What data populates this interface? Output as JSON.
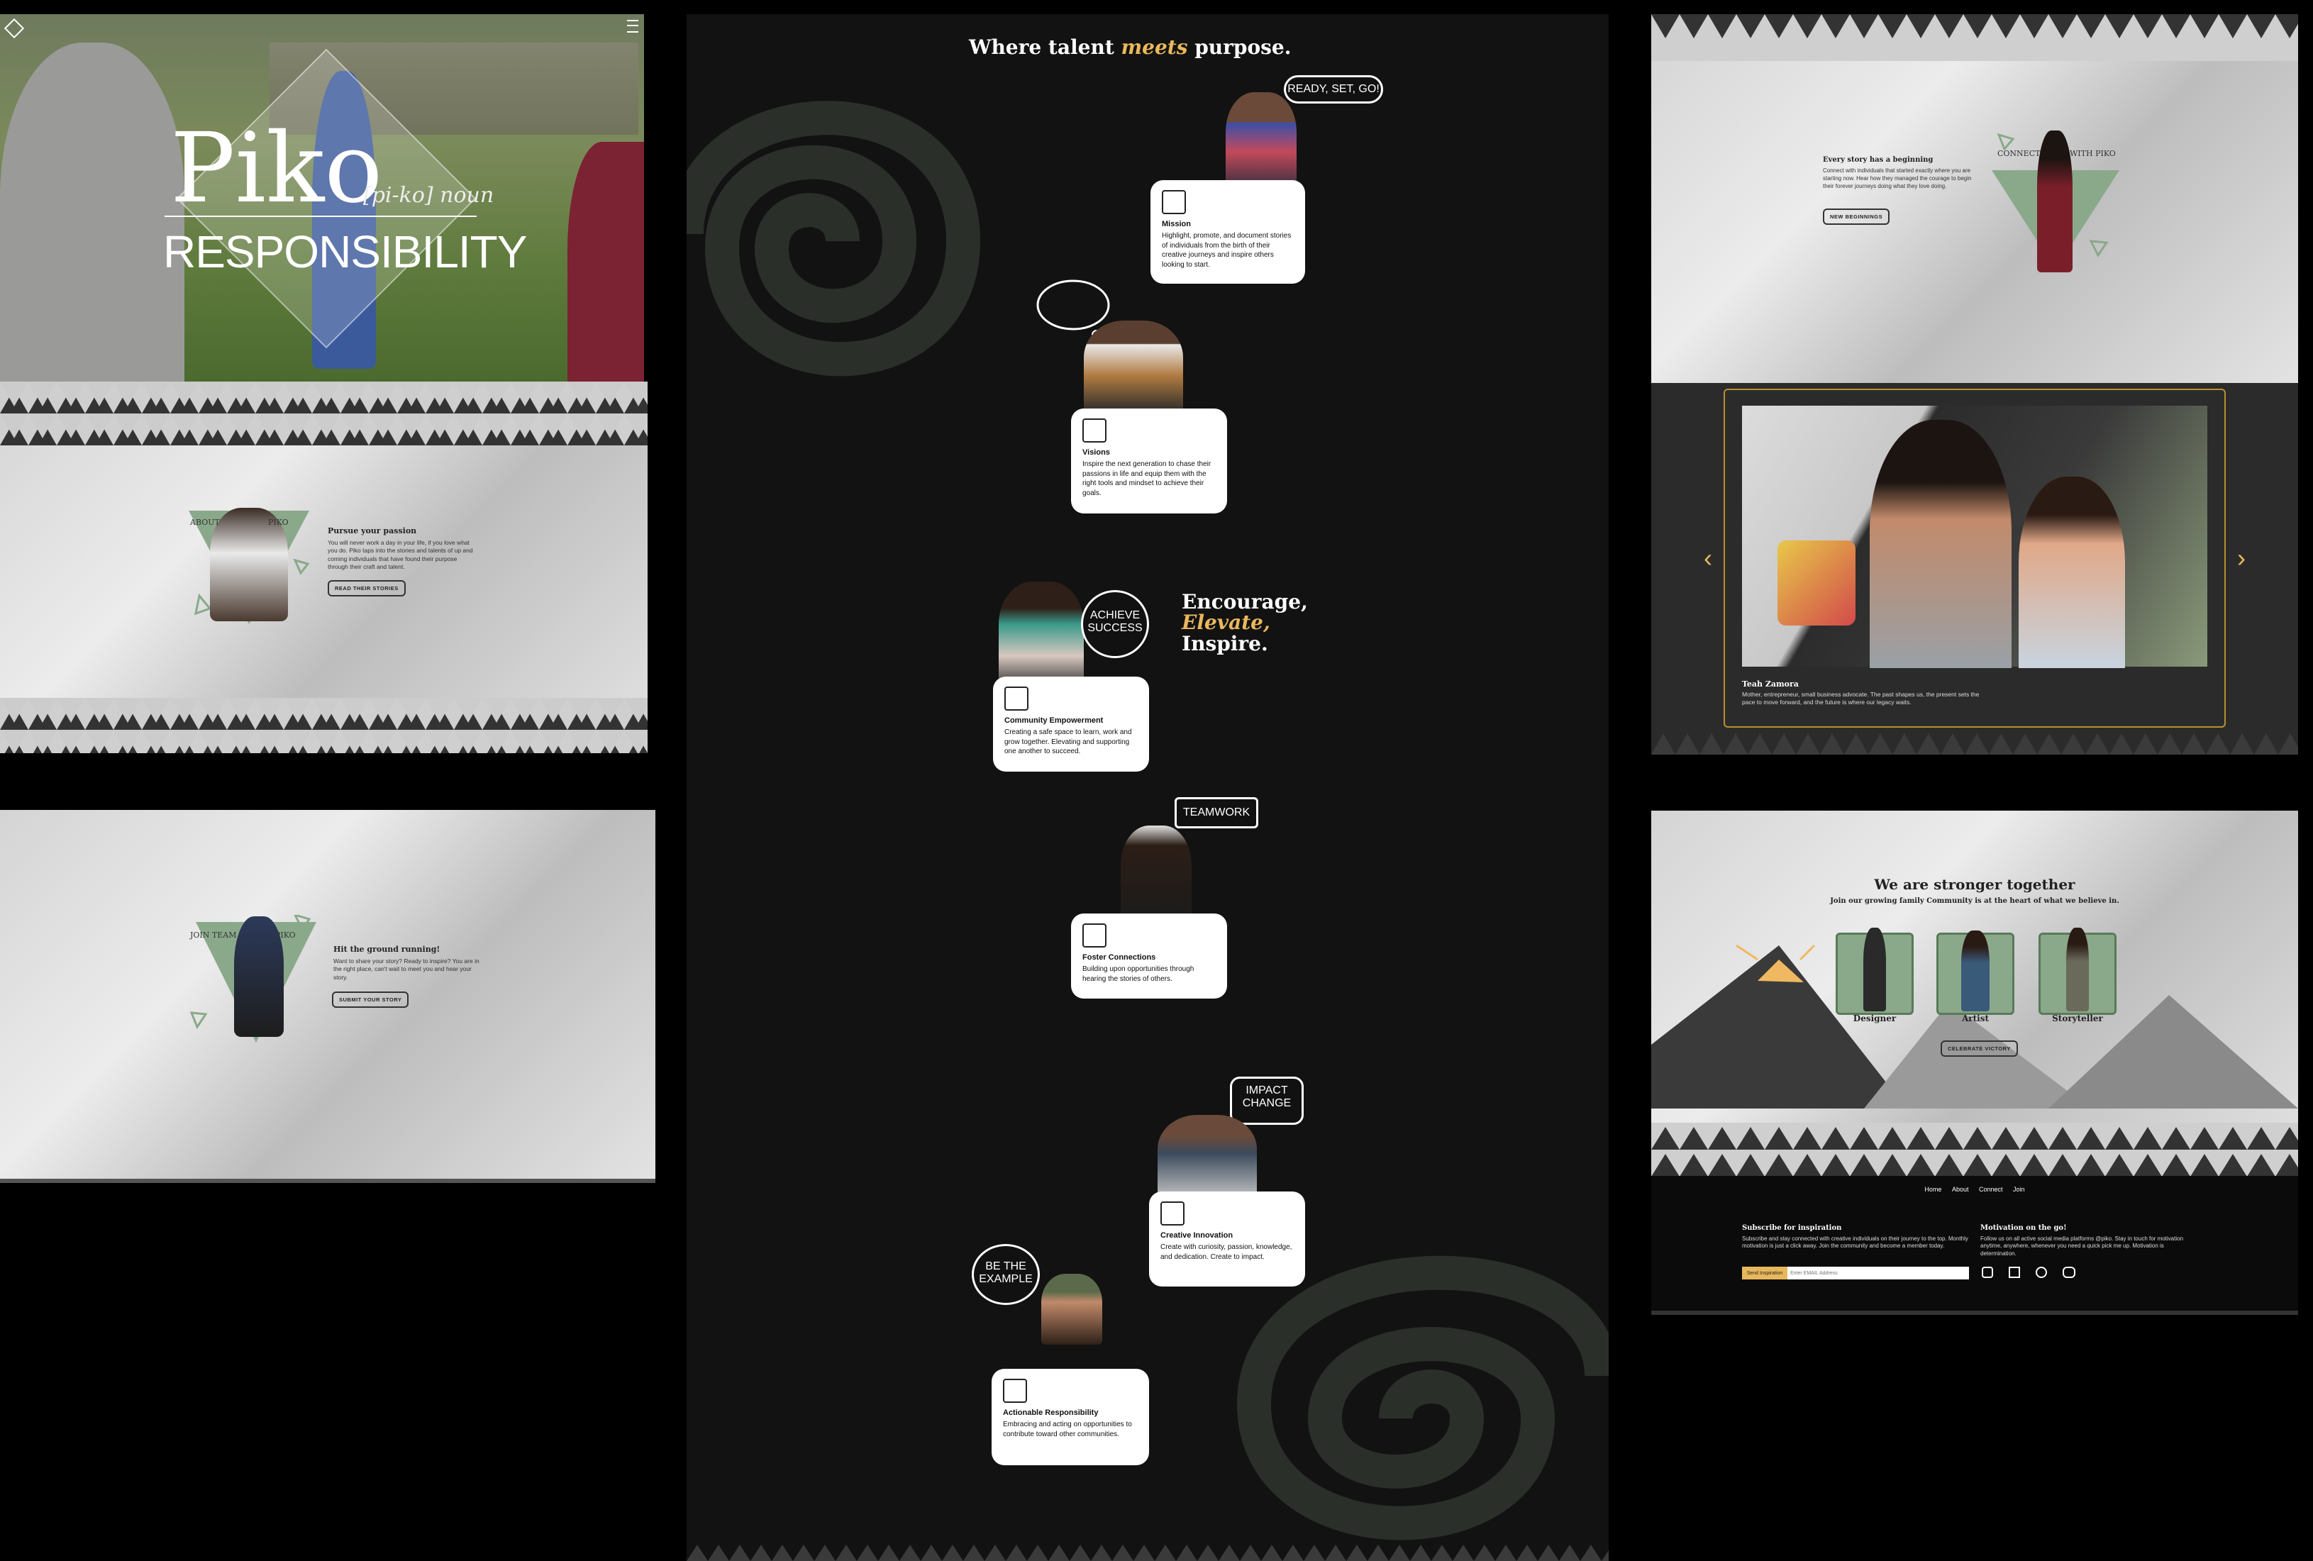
{
  "colors": {
    "accent": "#e9b85c",
    "sage": "#8aa98a",
    "dark": "#121212",
    "spiral": "#2a2f2a"
  },
  "hero": {
    "title": "Piko",
    "pronunciation": "[pi-ko] noun",
    "subtitle": "RESPONSIBILITY",
    "menu_icon": "hamburger-icon",
    "logo_icon": "diamond-logo-icon"
  },
  "about": {
    "tri_left": "ABOUT",
    "tri_right": "PIKO",
    "heading": "Pursue your passion",
    "body": "You will never work a day in your life, if you love what you do. Piko taps into the stories and talents of up and coming individuals that have found their purpose through their craft and talent.",
    "button": "READ THEIR STORIES"
  },
  "join": {
    "tri_left": "JOIN TEAM",
    "tri_right": "PIKO",
    "heading": "Hit the ground running!",
    "body": "Want to share your story? Ready to inspire? You are in the right place, can't wait to meet you and hear your story.",
    "button": "SUBMIT YOUR STORY"
  },
  "middle": {
    "headline_a": "Where talent ",
    "headline_em": "meets",
    "headline_b": " purpose.",
    "bubbles": {
      "ready": "READY, SET, GO!",
      "achieve": "ACHIEVE SUCCESS",
      "teamwork": "TEAMWORK",
      "impact": "IMPACT CHANGE",
      "example": "BE THE EXAMPLE"
    },
    "encourage_a": "Encourage,",
    "encourage_em": "Elevate,",
    "encourage_b": "Inspire.",
    "cards": [
      {
        "title": "Mission",
        "body": "Highlight, promote, and document stories of individuals from the birth of their creative journeys and inspire others looking to start."
      },
      {
        "title": "Visions",
        "body": "Inspire the next generation to chase their passions in life and equip them with the right tools and mindset to achieve their goals."
      },
      {
        "title": "Community Empowerment",
        "body": "Creating a safe space to learn, work and grow together. Elevating and supporting one another to succeed."
      },
      {
        "title": "Foster Connections",
        "body": "Building upon opportunities through hearing the stories of others."
      },
      {
        "title": "Creative Innovation",
        "body": "Create with curiosity, passion, knowledge, and dedication. Create to impact."
      },
      {
        "title": "Actionable Responsibility",
        "body": "Embracing and acting on opportunities to contribute toward other communities."
      }
    ]
  },
  "connect": {
    "tri_left": "CONNECT",
    "tri_right": "WITH PIKO",
    "heading": "Every story has a beginning",
    "body": "Connect with individuals that started exactly where you are starting now. Hear how they managed the courage to begin their forever journeys doing what they love doing.",
    "button": "NEW BEGINNINGS"
  },
  "carousel": {
    "name": "Teah Zamora",
    "caption": "Mother, entrepreneur, small business advocate. The past shapes us, the present sets the pace to move forward, and the future is where our legacy waits.",
    "prev": "‹",
    "next": "›"
  },
  "community": {
    "heading": "We are stronger together",
    "sub": "Join our growing family Community is at the heart of what we believe in.",
    "members": [
      "Designer",
      "Artist",
      "Storyteller"
    ],
    "button": "CELEBRATE VICTORY"
  },
  "footer": {
    "nav": [
      "Home",
      "About",
      "Connect",
      "Join"
    ],
    "subscribe_title": "Subscribe for inspiration",
    "subscribe_body": "Subscribe and stay connected with creative individuals on their journey to the top. Monthly motivation is just a click away. Join the community and become a member today.",
    "send_btn": "Send Inspiration",
    "email_placeholder": "Enter EMAIL Address",
    "motivation_title": "Motivation on the go!",
    "motivation_body": "Follow us on all active social media platforms @piko. Stay in touch for motivation anytime, anywhere, whenever you need a quick pick me up. Motivation is determination.",
    "social_icons": [
      "instagram-icon",
      "email-icon",
      "pinterest-icon",
      "discord-icon"
    ]
  }
}
